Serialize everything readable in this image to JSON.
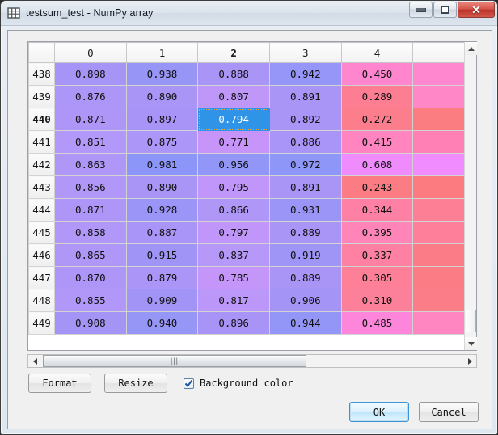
{
  "window": {
    "title": "testsum_test - NumPy array",
    "icon": "grid-icon",
    "controls": {
      "minimize": "minimize-icon",
      "maximize": "maximize-icon",
      "close": "close-icon"
    }
  },
  "table": {
    "columns": [
      "0",
      "1",
      "2",
      "3",
      "4"
    ],
    "selected_column": "2",
    "selected_row": "440",
    "selected_value": "0.794",
    "rows": [
      {
        "header": "438",
        "values": [
          "0.898",
          "0.938",
          "0.888",
          "0.942",
          "0.450"
        ]
      },
      {
        "header": "439",
        "values": [
          "0.876",
          "0.890",
          "0.807",
          "0.891",
          "0.289"
        ]
      },
      {
        "header": "440",
        "values": [
          "0.871",
          "0.897",
          "0.794",
          "0.892",
          "0.272"
        ]
      },
      {
        "header": "441",
        "values": [
          "0.851",
          "0.875",
          "0.771",
          "0.886",
          "0.415"
        ]
      },
      {
        "header": "442",
        "values": [
          "0.863",
          "0.981",
          "0.956",
          "0.972",
          "0.608"
        ]
      },
      {
        "header": "443",
        "values": [
          "0.856",
          "0.890",
          "0.795",
          "0.891",
          "0.243"
        ]
      },
      {
        "header": "444",
        "values": [
          "0.871",
          "0.928",
          "0.866",
          "0.931",
          "0.344"
        ]
      },
      {
        "header": "445",
        "values": [
          "0.858",
          "0.887",
          "0.797",
          "0.889",
          "0.395"
        ]
      },
      {
        "header": "446",
        "values": [
          "0.865",
          "0.915",
          "0.837",
          "0.919",
          "0.337"
        ]
      },
      {
        "header": "447",
        "values": [
          "0.870",
          "0.879",
          "0.785",
          "0.889",
          "0.305"
        ]
      },
      {
        "header": "448",
        "values": [
          "0.855",
          "0.909",
          "0.817",
          "0.906",
          "0.310"
        ]
      },
      {
        "header": "449",
        "values": [
          "0.908",
          "0.940",
          "0.896",
          "0.944",
          "0.485"
        ]
      }
    ],
    "sliver_colors": [
      "#ff87d0",
      "#ff87c8",
      "#fb7d82",
      "#ff80b4",
      "#f08cff",
      "#fb7b80",
      "#fd7f95",
      "#fd7f9a",
      "#fb7c86",
      "#fb7c84",
      "#fb7d88",
      "#ff86c0"
    ]
  },
  "colors": {
    "selection_bg": "#2f93e8",
    "selection_text": "#ffffff",
    "focus_outline": "#e8a33d",
    "dialog_bg": "#f0f0f0",
    "close_button": "#b93228"
  },
  "controls": {
    "format_label": "Format",
    "resize_label": "Resize",
    "background_color_label": "Background color",
    "background_color_checked": true,
    "ok_label": "OK",
    "cancel_label": "Cancel"
  }
}
